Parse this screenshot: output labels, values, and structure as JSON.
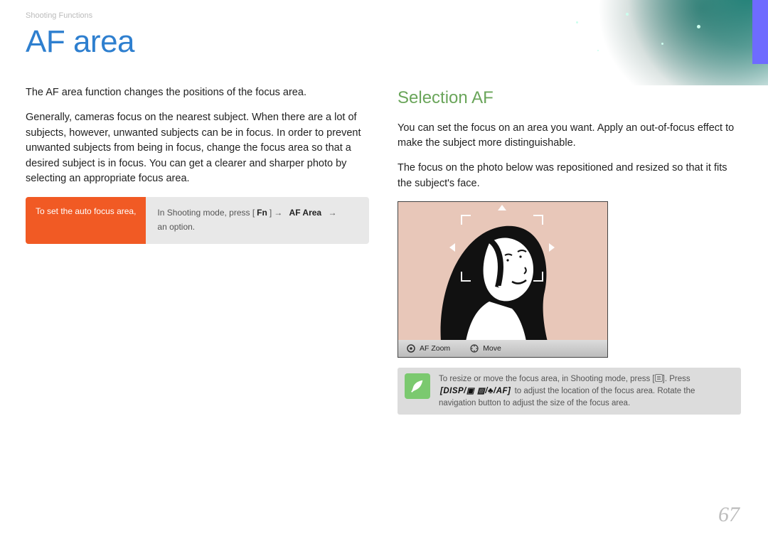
{
  "breadcrumb": "Shooting Functions",
  "title": "AF area",
  "page_number": "67",
  "left": {
    "intro": "The AF area function changes the positions of the focus area.",
    "body": "Generally, cameras focus on the nearest subject. When there are a lot of subjects, however, unwanted subjects can be in focus. In order to prevent unwanted subjects from being in focus, change the focus area so that a desired subject is in focus. You can get a clearer and sharper photo by selecting an appropriate focus area.",
    "instr_label": "To set the auto focus area,",
    "instr_pre": "In Shooting mode, press [",
    "instr_fn": "Fn",
    "instr_mid1": "] ",
    "instr_arrow": "→",
    "instr_afarea": "AF Area",
    "instr_post": " an option."
  },
  "right": {
    "subhead": "Selection AF",
    "p1": "You can set the focus on an area you want. Apply an out-of-focus effect to make the subject more distinguishable.",
    "p2": "The focus on the photo below was repositioned and resized so that it fits the subject's face.",
    "bar_zoom": "AF Zoom",
    "bar_move": "Move",
    "tip_pre": "To resize or move the focus area, in Shooting mode, press [",
    "tip_mid": "]. Press ",
    "tip_keys": "[DISP/▣ ▨/♣/AF]",
    "tip_post": " to adjust the location of the focus area. Rotate the navigation button to adjust the size of the focus area."
  }
}
